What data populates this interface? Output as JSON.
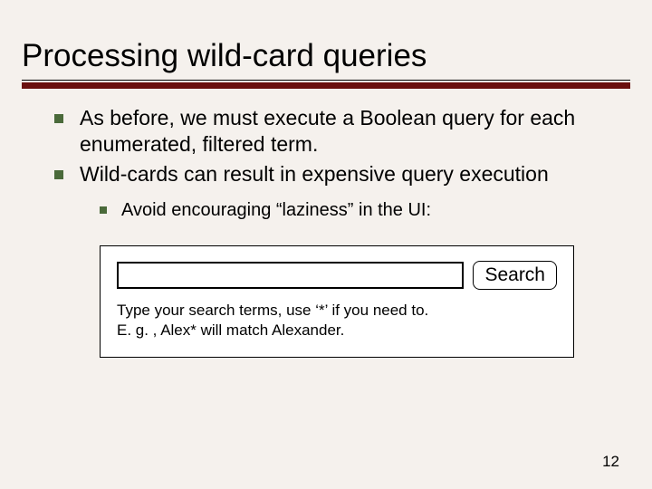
{
  "title": "Processing wild-card queries",
  "bullets": [
    "As before, we must execute a Boolean query for each enumerated, filtered term.",
    "Wild-cards can result in expensive query execution"
  ],
  "sub_bullet": "Avoid encouraging “laziness” in the UI:",
  "search": {
    "input_value": "",
    "button_label": "Search",
    "hint_line1": "Type your search terms, use ‘*’ if you need to.",
    "hint_line2": "E. g. , Alex* will match Alexander."
  },
  "page_number": "12"
}
